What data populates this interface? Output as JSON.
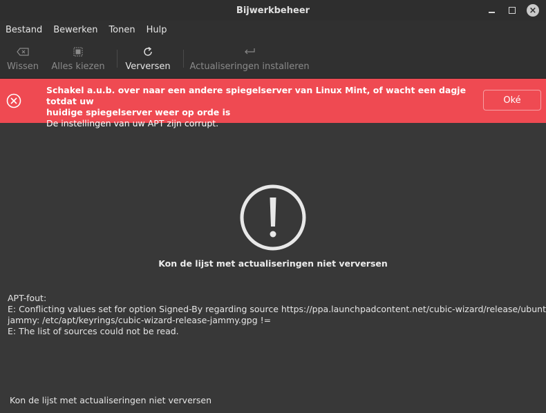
{
  "window": {
    "title": "Bijwerkbeheer"
  },
  "menu": [
    "Bestand",
    "Bewerken",
    "Tonen",
    "Hulp"
  ],
  "toolbar": {
    "clear": "Wissen",
    "select_all": "Alles kiezen",
    "refresh": "Verversen",
    "install": "Actualiseringen installeren"
  },
  "infobar": {
    "title_line1": "Schakel a.u.b. over naar een andere spiegelserver van Linux Mint, of wacht een dagje totdat uw",
    "title_line2": "huidige spiegelserver weer op orde is",
    "message": "De instellingen van uw APT zijn corrupt.",
    "ok": "Oké",
    "color": "#ef4a52"
  },
  "main": {
    "heading": "Kon de lijst met actualiseringen niet verversen",
    "error_lines": [
      "APT-fout:",
      "E: Conflicting values set for option Signed-By regarding source https://ppa.launchpadcontent.net/cubic-wizard/release/ubuntu/",
      "jammy: /etc/apt/keyrings/cubic-wizard-release-jammy.gpg !=",
      "E: The list of sources could not be read."
    ]
  },
  "statusbar": {
    "text": "Kon de lijst met actualiseringen niet verversen"
  }
}
